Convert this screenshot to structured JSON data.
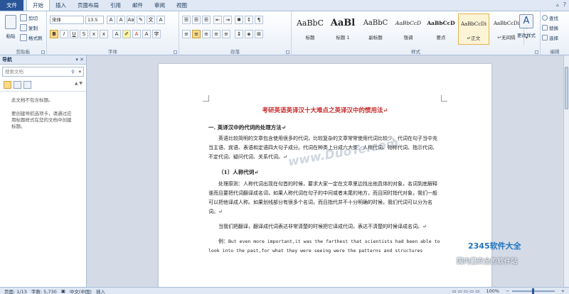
{
  "tabs": [
    {
      "label": "文件"
    },
    {
      "label": "开始"
    },
    {
      "label": "插入"
    },
    {
      "label": "页面布局"
    },
    {
      "label": "引用"
    },
    {
      "label": "邮件"
    },
    {
      "label": "审阅"
    },
    {
      "label": "视图"
    }
  ],
  "clipboard": {
    "paste": "粘贴",
    "cut": "剪切",
    "copy": "复制",
    "format_painter": "格式刷",
    "label": "剪贴板"
  },
  "font": {
    "name": "宋体",
    "size": "13.5",
    "label": "字体"
  },
  "paragraph": {
    "label": "段落"
  },
  "styles": {
    "label": "样式",
    "items": [
      {
        "sample": "AaBbC",
        "name": "标题"
      },
      {
        "sample": "AaBl",
        "name": "标题 1"
      },
      {
        "sample": "AaBbC",
        "name": "副标题"
      },
      {
        "sample": "AaBbCcD",
        "name": "强调"
      },
      {
        "sample": "AaBbCcD",
        "name": "要点"
      },
      {
        "sample": "AaBbCcDi",
        "name": "↵正文"
      },
      {
        "sample": "AaBbCcDi",
        "name": "↵无间隔"
      }
    ],
    "change_styles": "更改样式"
  },
  "editing": {
    "find": "查找",
    "replace": "替换",
    "select": "选择",
    "label": "编辑"
  },
  "nav": {
    "title": "导航",
    "search_placeholder": "搜索文档",
    "msg1": "此文档不包含标题。",
    "msg2": "要创建导航选项卡，请通过应用标题样式在您的文档中创建标题。"
  },
  "doc": {
    "title": "考研英语英译汉十大难点之英译汉中的惯用法↵",
    "h1": "一. 英译汉中的代词的处理方法↵",
    "p1": "英语比较简明的文章包含使用很多的代词，比较复杂的文章常常使用代词比较少。代词在句子当中充当主语、宾语、表语和定语四大句子成分。代词在种类上分成六大类：人称代词、物称代词、指示代词、不定代词、疑问代词、关系代词。↵",
    "h2": "（1）人称代词↵",
    "p2": "处理原则：人称代词出现在句首的时候，要求大家一定在文章里边找出他具体的对象，名词到底解释谁而且要把代词翻译成名词，如果人称代词在句子的中间或者末尾的地方，而且同时指代对象，我们一般可以把他译成人称。如果划线部分有很多个名词，而且指代并不十分明确的时候，我们代词可以分为名词。↵",
    "p3": "当我们把翻译，翻译成代词表达非常清楚的时候把它译成代词，表达不清楚的时候译成名词。↵",
    "p4_label": "例：",
    "p4": "But even more important,it was the farthest that scientists had been able to look into the past,for what they were seeing were the patterns and structures"
  },
  "watermark": "www.DuoTe.com",
  "logo": {
    "line1": "2345软件大全",
    "line2": "国内最安全的软件站"
  },
  "status": {
    "page": "页面: 1/13",
    "words": "字数: 5,730",
    "lang": "中文(中国)",
    "mode": "插入",
    "zoom": "100%"
  }
}
